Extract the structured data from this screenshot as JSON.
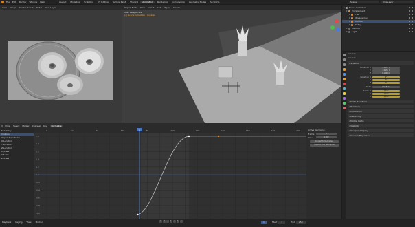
{
  "topbar": {
    "menus": [
      "File",
      "Edit",
      "Render",
      "Window",
      "Help"
    ],
    "workspaces": [
      "Layout",
      "Modeling",
      "Sculpting",
      "UV Editing",
      "Texture Paint",
      "Shading",
      "Animation",
      "Rendering",
      "Compositing",
      "Geometry Nodes",
      "Scripting"
    ],
    "active_workspace": "Animation",
    "scene": "Scene",
    "view_layer": "ViewLayer"
  },
  "image_editor": {
    "header": [
      "View",
      "Image",
      "Render Result",
      "Slot 1",
      "View Layer"
    ],
    "bg_color": "#a1a1a1"
  },
  "viewport": {
    "header": [
      "Object Mode",
      "View",
      "Select",
      "Add",
      "Object",
      "Global"
    ],
    "info_line1": "User Perspective",
    "info_line2": "(1) Scene Collection | Cookies"
  },
  "outliner": {
    "title": "Scene Collection",
    "rows": [
      {
        "label": "Scene Collection",
        "color": "#9a9a9a",
        "indent": 0,
        "sel": false
      },
      {
        "label": "Environment",
        "color": "#e3882a",
        "indent": 1,
        "sel": false
      },
      {
        "label": "Fries",
        "color": "#e3882a",
        "indent": 2,
        "sel": false
      },
      {
        "label": "Mikescanner",
        "color": "#e3882a",
        "indent": 2,
        "sel": false
      },
      {
        "label": "Cookies",
        "color": "#e3882a",
        "indent": 2,
        "sel": true
      },
      {
        "label": "Pastry",
        "color": "#e3882a",
        "indent": 2,
        "sel": false
      },
      {
        "label": "Camera",
        "color": "#6a6a6a",
        "indent": 1,
        "sel": false
      },
      {
        "label": "Light",
        "color": "#6a6a6a",
        "indent": 1,
        "sel": false
      }
    ]
  },
  "properties": {
    "object_name": "Cookies",
    "breadcrumb": "Cookies",
    "transform_header": "Transform",
    "location_label": "Location X",
    "location": [
      "-0.9874 m",
      "-0.6153 m",
      "0.1061 m"
    ],
    "rotation_label": "Rotation X",
    "rotation": [
      "0°",
      "0°",
      "0°"
    ],
    "mode_label": "Mode",
    "mode": "XYZ Euler",
    "scale_label": "Scale X",
    "scale": [
      "1.010",
      "1.010",
      "1.010"
    ],
    "sections": [
      "Delta Transform",
      "Relations",
      "Collections",
      "Instancing",
      "Motion Paths",
      "Visibility",
      "Viewport Display",
      "Custom Properties"
    ],
    "axis_y": "Y",
    "axis_z": "Z"
  },
  "graph_editor": {
    "header": [
      "View",
      "Select",
      "Marker",
      "Channel",
      "Key"
    ],
    "mode": "Normalize",
    "channels": [
      {
        "label": "Summary",
        "sel": false
      },
      {
        "label": "Cookies",
        "sel": true
      },
      {
        "label": "Object Transforms",
        "sel": false
      },
      {
        "label": "X Location",
        "sel": false
      },
      {
        "label": "Y Location",
        "sel": false
      },
      {
        "label": "Z Location",
        "sel": false
      },
      {
        "label": "X Scale",
        "sel": false
      },
      {
        "label": "Y Scale",
        "sel": false
      },
      {
        "label": "Z Scale",
        "sel": false
      }
    ],
    "frame_ticks": [
      "0",
      "10",
      "20",
      "30",
      "40",
      "50",
      "60",
      "70",
      "80",
      "90",
      "100",
      "110",
      "120",
      "130",
      "140",
      "150",
      "160",
      "170",
      "180",
      "190",
      "200"
    ],
    "value_ticks": [
      "1.0",
      "0.8",
      "0.6",
      "0.4",
      "0.2",
      "0.0",
      "-0.2",
      "-0.4",
      "-0.6",
      "-0.8",
      "-1.0"
    ],
    "current_frame": "1",
    "side": {
      "section": "Active Keyframe",
      "frame_label": "Frame",
      "frame_value": "1",
      "value_label": "Value",
      "value_value": "0.000",
      "btn1": "Convert to Keyframes",
      "btn2": "Convert from Keyframes"
    }
  },
  "timeline": {
    "menus": [
      "Playback",
      "Keying",
      "View",
      "Marker"
    ],
    "start_label": "Start",
    "start": "1",
    "end_label": "End",
    "end": "250",
    "current": "1"
  }
}
